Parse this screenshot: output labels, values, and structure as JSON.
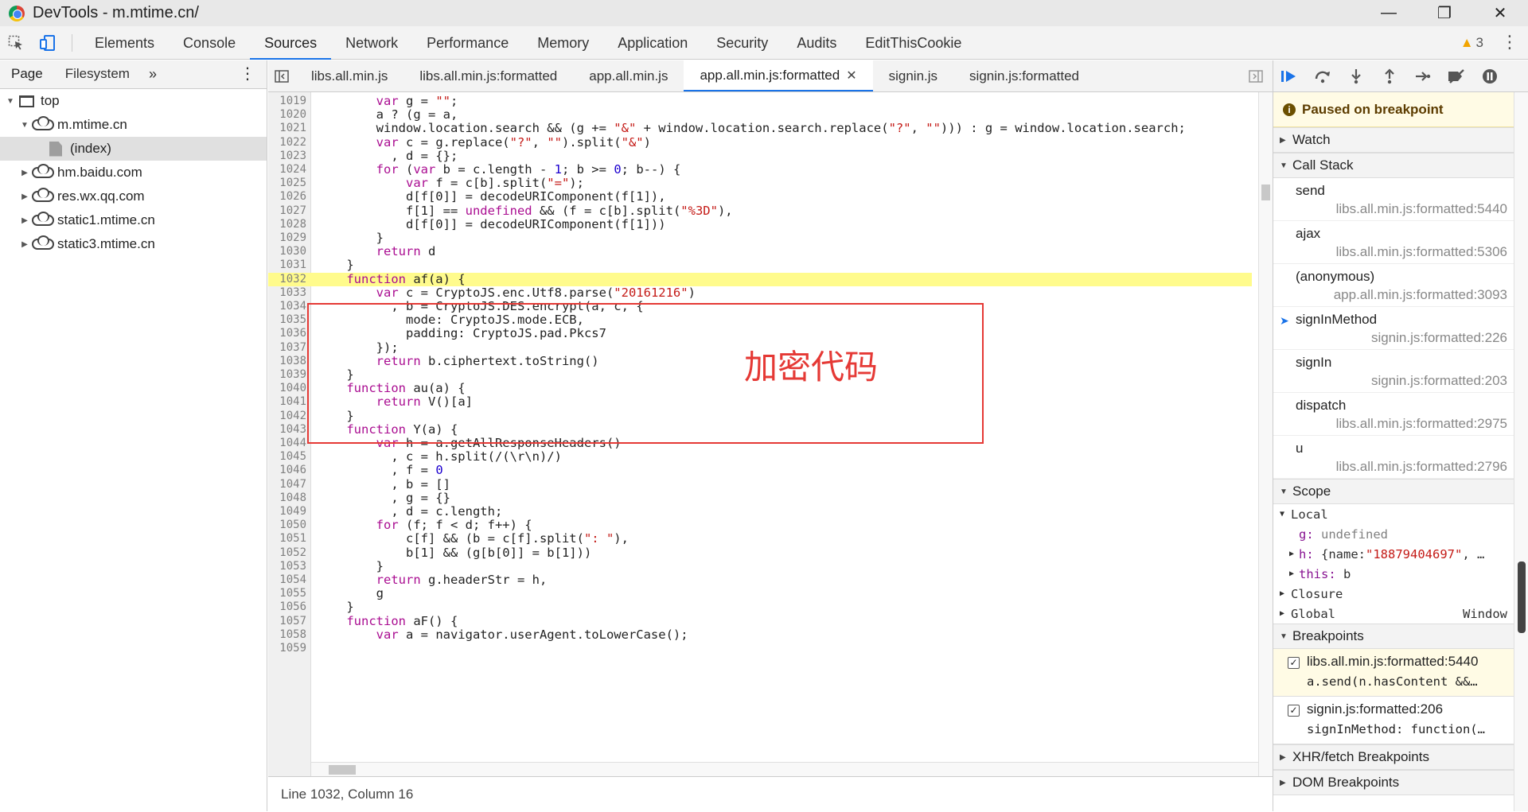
{
  "window": {
    "title": "DevTools - m.mtime.cn/"
  },
  "main_tabs": [
    "Elements",
    "Console",
    "Sources",
    "Network",
    "Performance",
    "Memory",
    "Application",
    "Security",
    "Audits",
    "EditThisCookie"
  ],
  "warnings": {
    "count": "3"
  },
  "navigator": {
    "tabs": [
      "Page",
      "Filesystem"
    ],
    "more": "»",
    "tree": [
      {
        "label": "top",
        "level": 0,
        "type": "frame",
        "expanded": true
      },
      {
        "label": "m.mtime.cn",
        "level": 1,
        "type": "domain",
        "expanded": true
      },
      {
        "label": "(index)",
        "level": 2,
        "type": "file",
        "selected": true
      },
      {
        "label": "hm.baidu.com",
        "level": 1,
        "type": "domain",
        "expanded": false
      },
      {
        "label": "res.wx.qq.com",
        "level": 1,
        "type": "domain",
        "expanded": false
      },
      {
        "label": "static1.mtime.cn",
        "level": 1,
        "type": "domain",
        "expanded": false
      },
      {
        "label": "static3.mtime.cn",
        "level": 1,
        "type": "domain",
        "expanded": false
      }
    ]
  },
  "editor_tabs": [
    {
      "label": "libs.all.min.js"
    },
    {
      "label": "libs.all.min.js:formatted"
    },
    {
      "label": "app.all.min.js"
    },
    {
      "label": "app.all.min.js:formatted",
      "active": true,
      "closable": true
    },
    {
      "label": "signin.js"
    },
    {
      "label": "signin.js:formatted"
    }
  ],
  "code_lines": [
    {
      "n": "1019",
      "t": "        var g = \"\";"
    },
    {
      "n": "1020",
      "t": "        a ? (g = a,"
    },
    {
      "n": "1021",
      "t": "        window.location.search && (g += \"&\" + window.location.search.replace(\"?\", \"\"))) : g = window.location.search;"
    },
    {
      "n": "1022",
      "t": "        var c = g.replace(\"?\", \"\").split(\"&\")"
    },
    {
      "n": "1023",
      "t": "          , d = {};"
    },
    {
      "n": "1024",
      "t": "        for (var b = c.length - 1; b >= 0; b--) {"
    },
    {
      "n": "1025",
      "t": "            var f = c[b].split(\"=\");"
    },
    {
      "n": "1026",
      "t": "            d[f[0]] = decodeURIComponent(f[1]),"
    },
    {
      "n": "1027",
      "t": "            f[1] == undefined && (f = c[b].split(\"%3D\"),"
    },
    {
      "n": "1028",
      "t": "            d[f[0]] = decodeURIComponent(f[1]))"
    },
    {
      "n": "1029",
      "t": "        }"
    },
    {
      "n": "1030",
      "t": "        return d"
    },
    {
      "n": "1031",
      "t": "    }"
    },
    {
      "n": "1032",
      "t": "    function af(a) {",
      "hl": true
    },
    {
      "n": "1033",
      "t": "        var c = CryptoJS.enc.Utf8.parse(\"20161216\")"
    },
    {
      "n": "1034",
      "t": "          , b = CryptoJS.DES.encrypt(a, c, {"
    },
    {
      "n": "1035",
      "t": "            mode: CryptoJS.mode.ECB,"
    },
    {
      "n": "1036",
      "t": "            padding: CryptoJS.pad.Pkcs7"
    },
    {
      "n": "1037",
      "t": "        });"
    },
    {
      "n": "1038",
      "t": "        return b.ciphertext.toString()"
    },
    {
      "n": "1039",
      "t": "    }"
    },
    {
      "n": "1040",
      "t": "    function au(a) {"
    },
    {
      "n": "1041",
      "t": "        return V()[a]"
    },
    {
      "n": "1042",
      "t": "    }"
    },
    {
      "n": "1043",
      "t": "    function Y(a) {"
    },
    {
      "n": "1044",
      "t": "        var h = a.getAllResponseHeaders()"
    },
    {
      "n": "1045",
      "t": "          , c = h.split(/(\\r\\n)/)"
    },
    {
      "n": "1046",
      "t": "          , f = 0"
    },
    {
      "n": "1047",
      "t": "          , b = []"
    },
    {
      "n": "1048",
      "t": "          , g = {}"
    },
    {
      "n": "1049",
      "t": "          , d = c.length;"
    },
    {
      "n": "1050",
      "t": "        for (f; f < d; f++) {"
    },
    {
      "n": "1051",
      "t": "            c[f] && (b = c[f].split(\": \"),"
    },
    {
      "n": "1052",
      "t": "            b[1] && (g[b[0]] = b[1]))"
    },
    {
      "n": "1053",
      "t": "        }"
    },
    {
      "n": "1054",
      "t": "        return g.headerStr = h,"
    },
    {
      "n": "1055",
      "t": "        g"
    },
    {
      "n": "1056",
      "t": "    }"
    },
    {
      "n": "1057",
      "t": "    function aF() {"
    },
    {
      "n": "1058",
      "t": "        var a = navigator.userAgent.toLowerCase();"
    },
    {
      "n": "1059",
      "t": ""
    }
  ],
  "annotation": {
    "text": "加密代码",
    "color": "#e53935"
  },
  "status_bar": {
    "position": "Line 1032, Column 16"
  },
  "debugger": {
    "paused_message": "Paused on breakpoint",
    "sections": {
      "watch": "Watch",
      "call_stack": "Call Stack",
      "scope": "Scope",
      "breakpoints": "Breakpoints",
      "xhr": "XHR/fetch Breakpoints",
      "dom": "DOM Breakpoints"
    },
    "call_stack": [
      {
        "name": "send",
        "location": "libs.all.min.js:formatted:5440"
      },
      {
        "name": "ajax",
        "location": "libs.all.min.js:formatted:5306"
      },
      {
        "name": "(anonymous)",
        "location": "app.all.min.js:formatted:3093"
      },
      {
        "name": "signInMethod",
        "location": "signin.js:formatted:226",
        "current": true
      },
      {
        "name": "signIn",
        "location": "signin.js:formatted:203"
      },
      {
        "name": "dispatch",
        "location": "libs.all.min.js:formatted:2975"
      },
      {
        "name": "u",
        "location": "libs.all.min.js:formatted:2796"
      }
    ],
    "scope": {
      "local_label": "Local",
      "g_key": "g:",
      "g_value": "undefined",
      "h_key": "h:",
      "h_prefix": "{name: ",
      "h_string": "\"18879404697\"",
      "h_suffix": ", …",
      "this_key": "this:",
      "this_value": "b",
      "closure_label": "Closure",
      "global_label": "Global",
      "global_value": "Window"
    },
    "breakpoints": [
      {
        "location": "libs.all.min.js:formatted:5440",
        "code": "a.send(n.hasContent &&…",
        "active": true
      },
      {
        "location": "signin.js:formatted:206",
        "code": "signInMethod: function(…",
        "active": false
      }
    ]
  },
  "colors": {
    "accent": "#1a73e8",
    "highlight": "#fffb8c",
    "annotation": "#e53935",
    "warning": "#f2a400"
  }
}
